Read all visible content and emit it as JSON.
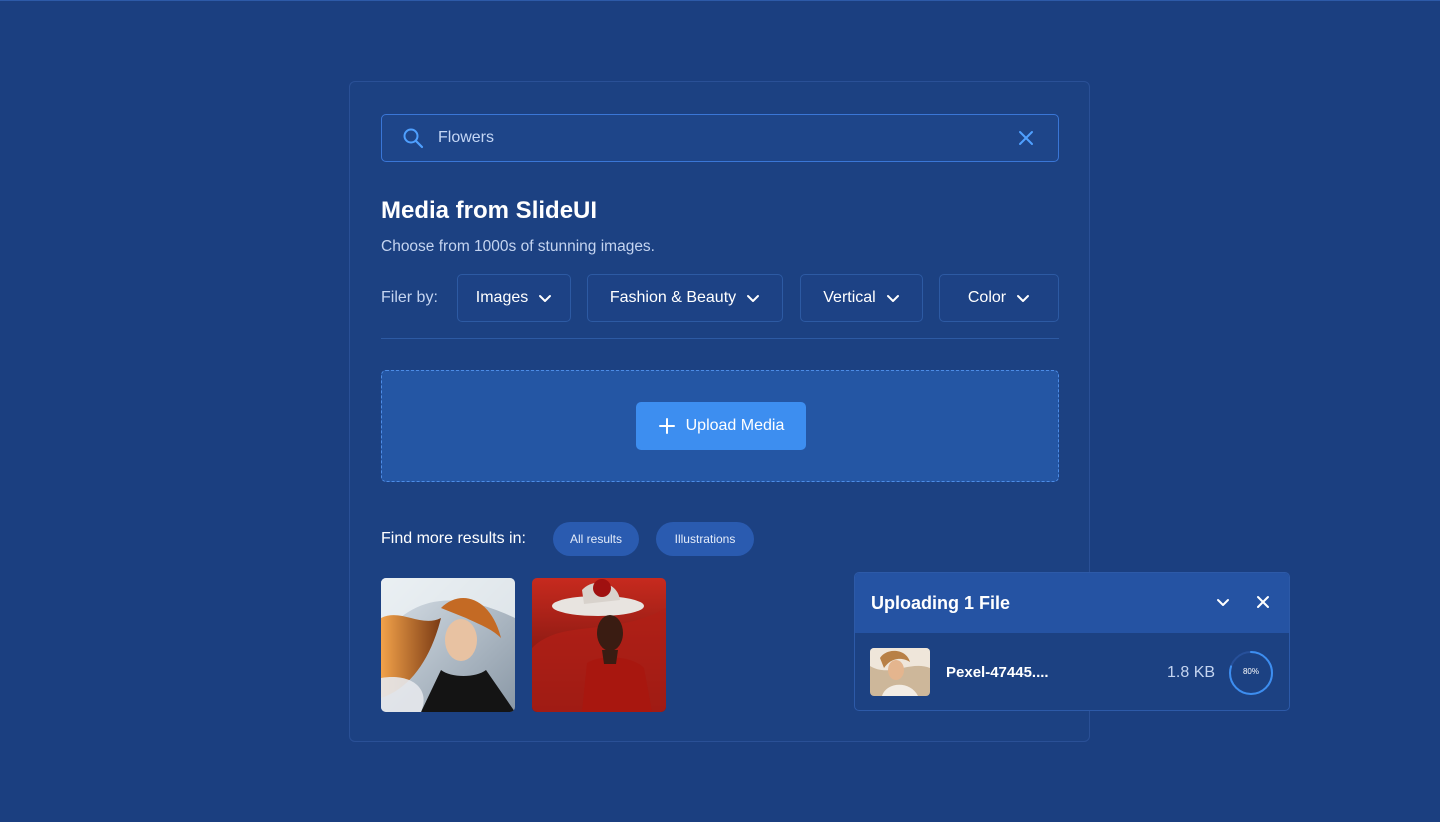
{
  "search": {
    "value": "Flowers",
    "icon": "search-icon",
    "clear_icon": "close-icon"
  },
  "header": {
    "title": "Media from SlideUI",
    "subtitle": "Choose from 1000s of stunning images."
  },
  "filters": {
    "label": "Filer by:",
    "items": [
      {
        "label": "Images"
      },
      {
        "label": "Fashion & Beauty"
      },
      {
        "label": "Vertical"
      },
      {
        "label": "Color"
      }
    ]
  },
  "upload": {
    "button_label": "Upload Media",
    "icon": "plus-icon"
  },
  "more_results": {
    "label": "Find more results in:",
    "pills": [
      "All results",
      "Illustrations"
    ]
  },
  "uploading": {
    "title": "Uploading 1 File",
    "file": {
      "name": "Pexel-47445....",
      "size": "1.8 KB",
      "progress": 0.8,
      "progress_label": "80%"
    }
  },
  "colors": {
    "background": "#1b3f80",
    "accent": "#3d8ef0",
    "panel": "#1c4182",
    "dropzone": "#2456a4"
  }
}
